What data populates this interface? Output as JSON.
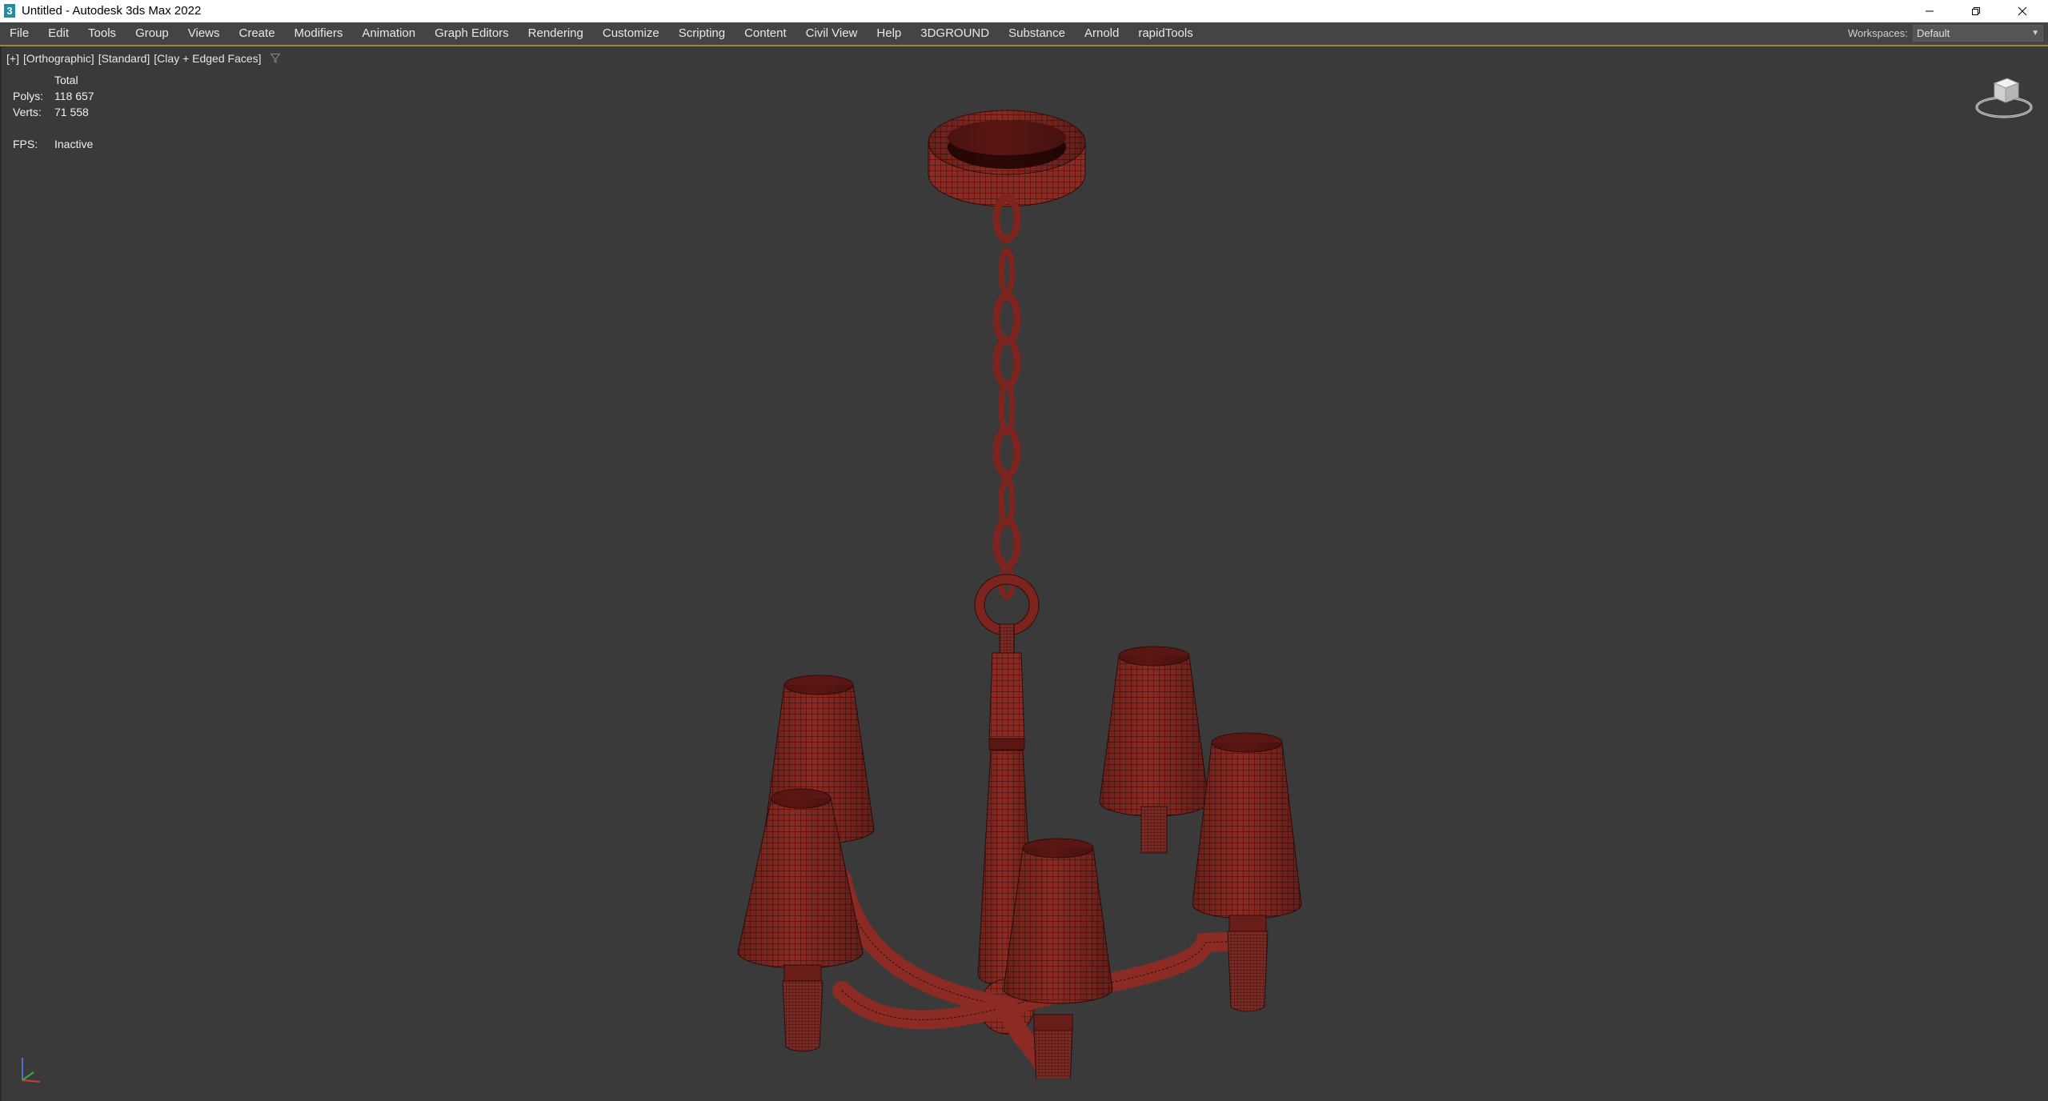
{
  "window": {
    "app_icon_glyph": "3",
    "title": "Untitled - Autodesk 3ds Max 2022"
  },
  "menu": {
    "items": [
      "File",
      "Edit",
      "Tools",
      "Group",
      "Views",
      "Create",
      "Modifiers",
      "Animation",
      "Graph Editors",
      "Rendering",
      "Customize",
      "Scripting",
      "Content",
      "Civil View",
      "Help",
      "3DGROUND",
      "Substance",
      "Arnold",
      "rapidTools"
    ],
    "workspace_label": "Workspaces:",
    "workspace_value": "Default"
  },
  "viewport": {
    "label_plus": "[+]",
    "label_view": "[Orthographic]",
    "label_shading": "[Standard]",
    "label_style": "[Clay + Edged Faces]"
  },
  "stats": {
    "total_header": "Total",
    "polys_label": "Polys:",
    "polys_value": "118 657",
    "verts_label": "Verts:",
    "verts_value": "71 558",
    "fps_label": "FPS:",
    "fps_value": "Inactive"
  },
  "colors": {
    "viewport_bg": "#3a3a3a",
    "model": "#8a2a22",
    "wire": "#2e0c0a",
    "menu_bg": "#444444"
  },
  "icons": {
    "filter": "funnel-icon",
    "viewcube": "viewcube-icon",
    "axis": "axis-tripod-icon"
  }
}
